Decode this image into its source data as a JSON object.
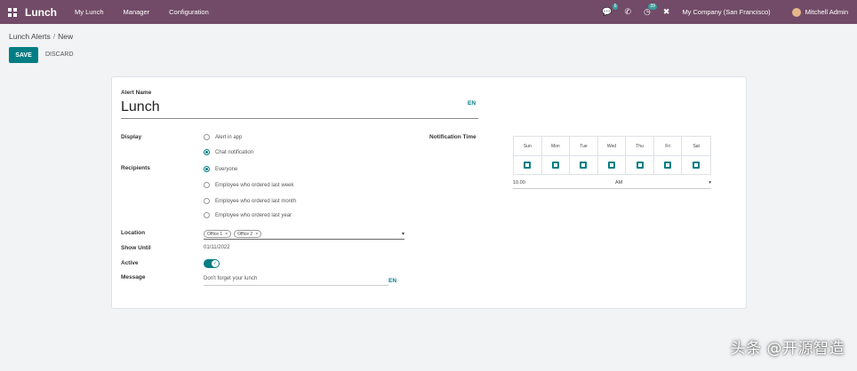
{
  "navbar": {
    "brand": "Lunch",
    "menu": [
      "My Lunch",
      "Manager",
      "Configuration"
    ],
    "chat_badge": "6",
    "activity_badge": "39",
    "company": "My Company (San Francisco)",
    "user": "Mitchell Admin"
  },
  "breadcrumb": {
    "parent": "Lunch Alerts",
    "current": "New"
  },
  "buttons": {
    "save": "SAVE",
    "discard": "DISCARD"
  },
  "form": {
    "name_label": "Alert Name",
    "name_value": "Lunch",
    "lang": "EN",
    "display_label": "Display",
    "display_options": [
      {
        "label": "Alert in app",
        "checked": false
      },
      {
        "label": "Chat notification",
        "checked": true
      }
    ],
    "recipients_label": "Recipients",
    "recipient_options": [
      {
        "label": "Everyone",
        "checked": true
      },
      {
        "label": "Employee who ordered last week",
        "checked": false
      },
      {
        "label": "Employee who ordered last month",
        "checked": false
      },
      {
        "label": "Employee who ordered last year",
        "checked": false
      }
    ],
    "location_label": "Location",
    "location_tags": [
      "Office 1",
      "Office 2"
    ],
    "show_until_label": "Show Until",
    "show_until_value": "01/11/2022",
    "active_label": "Active",
    "active": true,
    "message_label": "Message",
    "message_value": "Don't forget your lunch",
    "message_lang": "EN",
    "notification_time_label": "Notification Time",
    "weekdays": [
      "Sun",
      "Mon",
      "Tue",
      "Wed",
      "Thu",
      "Fri",
      "Sat"
    ],
    "time_value": "10.00",
    "time_period": "AM"
  },
  "watermark": "头条 @开源智造",
  "colors": {
    "navbar": "#714b67",
    "primary": "#017e84"
  }
}
